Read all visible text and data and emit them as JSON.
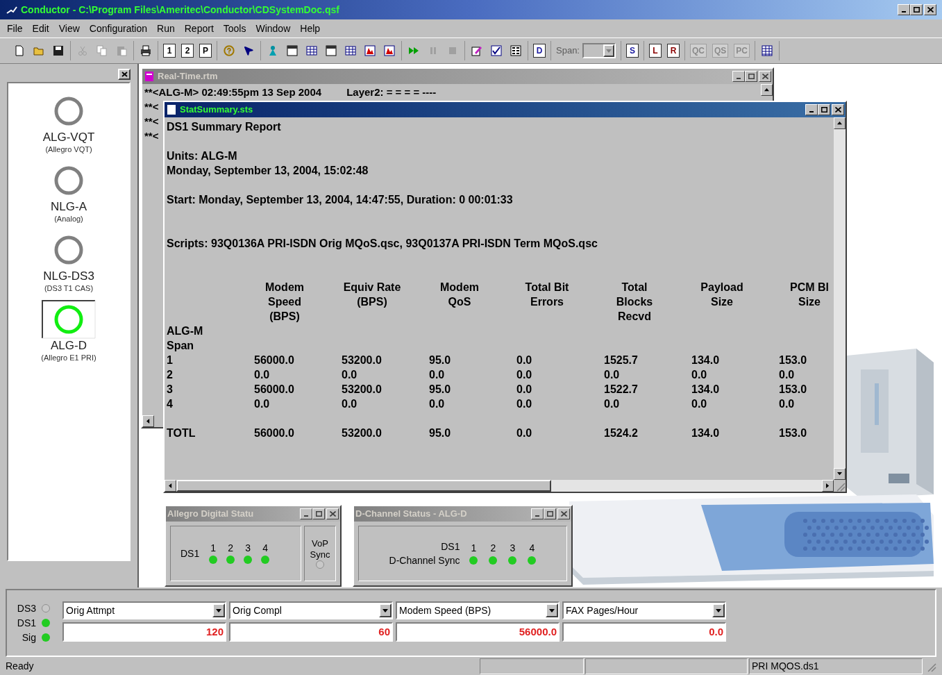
{
  "window": {
    "title": "Conductor - C:\\Program Files\\Ameritec\\Conductor\\CDSystemDoc.qsf"
  },
  "menu": [
    "File",
    "Edit",
    "View",
    "Configuration",
    "Run",
    "Report",
    "Tools",
    "Window",
    "Help"
  ],
  "toolbar": {
    "groups": [
      [
        {
          "kind": "new",
          "disabled": false
        },
        {
          "kind": "open",
          "disabled": false
        },
        {
          "kind": "save",
          "disabled": false
        }
      ],
      [
        {
          "kind": "cut",
          "disabled": true
        },
        {
          "kind": "copy",
          "disabled": true
        },
        {
          "kind": "paste",
          "disabled": true
        }
      ],
      [
        {
          "kind": "print",
          "disabled": false
        }
      ],
      [
        {
          "kind": "letter",
          "glyph": "1",
          "color": "#000000",
          "disabled": false
        },
        {
          "kind": "letter",
          "glyph": "2",
          "color": "#000000",
          "disabled": false
        },
        {
          "kind": "letter",
          "glyph": "P",
          "color": "#000000",
          "disabled": false
        }
      ],
      [
        {
          "kind": "help",
          "disabled": false
        },
        {
          "kind": "pointer",
          "disabled": false
        }
      ],
      [
        {
          "kind": "figure",
          "disabled": false
        },
        {
          "kind": "window",
          "disabled": false
        },
        {
          "kind": "table",
          "disabled": false
        },
        {
          "kind": "window",
          "disabled": false
        },
        {
          "kind": "table",
          "disabled": false
        },
        {
          "kind": "chart",
          "disabled": false
        },
        {
          "kind": "chart",
          "disabled": false
        }
      ],
      [
        {
          "kind": "play",
          "disabled": false
        },
        {
          "kind": "pause",
          "disabled": true
        },
        {
          "kind": "stop",
          "disabled": true
        }
      ],
      [
        {
          "kind": "edit",
          "disabled": false
        },
        {
          "kind": "check",
          "disabled": false
        },
        {
          "kind": "list",
          "disabled": false
        }
      ],
      [
        {
          "kind": "letter",
          "glyph": "D",
          "color": "#1a1aa0",
          "disabled": false
        }
      ],
      [
        {
          "kind": "span",
          "label": "Span:",
          "disabled": true
        }
      ],
      [
        {
          "kind": "letter",
          "glyph": "S",
          "color": "#1a1aa0",
          "disabled": false
        }
      ],
      [
        {
          "kind": "letter",
          "glyph": "L",
          "color": "#8b0000",
          "disabled": false
        },
        {
          "kind": "letter",
          "glyph": "R",
          "color": "#8b0000",
          "disabled": false
        }
      ],
      [
        {
          "kind": "letter",
          "glyph": "QC",
          "color": "#8a8a8a",
          "disabled": true
        },
        {
          "kind": "letter",
          "glyph": "QS",
          "color": "#8a8a8a",
          "disabled": true
        },
        {
          "kind": "letter",
          "glyph": "PC",
          "color": "#8a8a8a",
          "disabled": true
        }
      ],
      [
        {
          "kind": "grid",
          "disabled": false
        }
      ]
    ]
  },
  "units": [
    {
      "name": "ALG-VQT",
      "subtitle": "(Allegro VQT)",
      "on": false,
      "selected": false
    },
    {
      "name": "NLG-A",
      "subtitle": "(Analog)",
      "on": false,
      "selected": false
    },
    {
      "name": "NLG-DS3",
      "subtitle": "(DS3 T1 CAS)",
      "on": false,
      "selected": false
    },
    {
      "name": "ALG-D",
      "subtitle": "(Allegro E1 PRI)",
      "on": true,
      "selected": true
    }
  ],
  "realtime": {
    "title": "Real-Time.rtm",
    "active": false,
    "lines": [
      {
        "text": "**<ALG-M> 02:49:55pm  13 Sep 2004",
        "extra": "Layer2: = = = =  ----"
      },
      {
        "text": "**<"
      },
      {
        "text": "**<"
      },
      {
        "text": "**<"
      }
    ]
  },
  "stat": {
    "title": "StatSummary.sts",
    "active": true,
    "heading": "DS1 Summary Report",
    "units": "Units: ALG-M",
    "date": "Monday, September 13, 2004, 15:02:48",
    "start": "Start: Monday, September 13, 2004, 14:47:55, Duration: 0 00:01:33",
    "scripts": "Scripts: 93Q0136A PRI-ISDN Orig MQoS.qsc, 93Q0137A PRI-ISDN Term MQoS.qsc",
    "columns": [
      "ALG-M\nSpan",
      "Modem\nSpeed\n(BPS)",
      "Equiv Rate\n(BPS)",
      "Modem QoS",
      "Total Bit\nErrors",
      "Total\nBlocks\nRecvd",
      "Payload\nSize",
      "PCM Bl\nSize"
    ],
    "rows": [
      [
        "1",
        "56000.0",
        "53200.0",
        "95.0",
        "0.0",
        "1525.7",
        "134.0",
        "153.0"
      ],
      [
        "2",
        "0.0",
        "0.0",
        "0.0",
        "0.0",
        "0.0",
        "0.0",
        "0.0"
      ],
      [
        "3",
        "56000.0",
        "53200.0",
        "95.0",
        "0.0",
        "1522.7",
        "134.0",
        "153.0"
      ],
      [
        "4",
        "0.0",
        "0.0",
        "0.0",
        "0.0",
        "0.0",
        "0.0",
        "0.0"
      ]
    ],
    "total": [
      "TOTL",
      "56000.0",
      "53200.0",
      "95.0",
      "0.0",
      "1524.2",
      "134.0",
      "153.0"
    ]
  },
  "allegro": {
    "title": "Allegro Digital Statu",
    "active": false,
    "label": "DS1",
    "leds": [
      {
        "label": "1",
        "on": true
      },
      {
        "label": "2",
        "on": true
      },
      {
        "label": "3",
        "on": true
      },
      {
        "label": "4",
        "on": true
      }
    ],
    "vop": {
      "label": "VoP Sync",
      "on": false
    }
  },
  "dchannel": {
    "title": "D-Channel Status - ALG-D",
    "active": false,
    "label": "DS1",
    "sync_label": "D-Channel Sync",
    "leds": [
      {
        "label": "1",
        "on": true
      },
      {
        "label": "2",
        "on": true
      },
      {
        "label": "3",
        "on": true
      },
      {
        "label": "4",
        "on": true
      }
    ]
  },
  "bottom": {
    "indicators": [
      {
        "label": "DS3",
        "on": false
      },
      {
        "label": "DS1",
        "on": true
      },
      {
        "label": "Sig",
        "on": true
      }
    ],
    "meters": [
      {
        "stat": "Orig Attmpt",
        "value": "120"
      },
      {
        "stat": "Orig Compl",
        "value": "60"
      },
      {
        "stat": "Modem Speed (BPS)",
        "value": "56000.0"
      },
      {
        "stat": "FAX Pages/Hour",
        "value": "0.0"
      }
    ]
  },
  "status_bar": {
    "message": "Ready",
    "file": "PRI MQOS.ds1"
  }
}
